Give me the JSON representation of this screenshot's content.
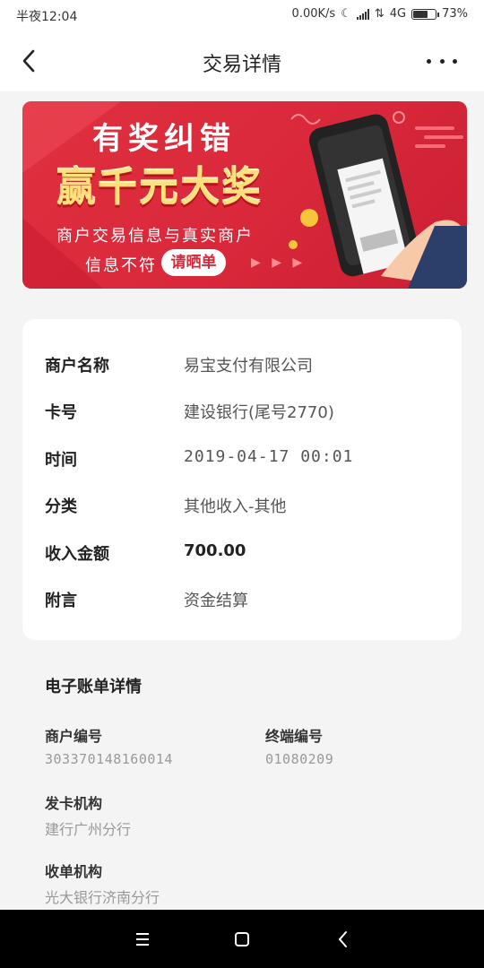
{
  "status_bar": {
    "time": "半夜12:04",
    "speed": "0.00K/s",
    "network": "4G",
    "battery": "73%",
    "battery_level": 0.73
  },
  "nav": {
    "title": "交易详情"
  },
  "banner": {
    "headline": "有奖纠错",
    "prize": "赢千元大奖",
    "line1": "商户交易信息与真实商户",
    "line2": "信息不符",
    "button": "请晒单",
    "arrows": "▶ ▶ ▶"
  },
  "details": {
    "merchant_label": "商户名称",
    "merchant_value": "易宝支付有限公司",
    "card_label": "卡号",
    "card_value": "建设银行(尾号2770)",
    "time_label": "时间",
    "time_value": "2019-04-17 00:01",
    "category_label": "分类",
    "category_value": "其他收入-其他",
    "amount_label": "收入金额",
    "amount_value": "700.00",
    "note_label": "附言",
    "note_value": "资金结算"
  },
  "ebill": {
    "title": "电子账单详情",
    "merchant_no_label": "商户编号",
    "merchant_no_value": "303370148160014",
    "terminal_no_label": "终端编号",
    "terminal_no_value": "01080209",
    "issuer_label": "发卡机构",
    "issuer_value": "建行广州分行",
    "acquirer_label": "收单机构",
    "acquirer_value": "光大银行济南分行"
  }
}
